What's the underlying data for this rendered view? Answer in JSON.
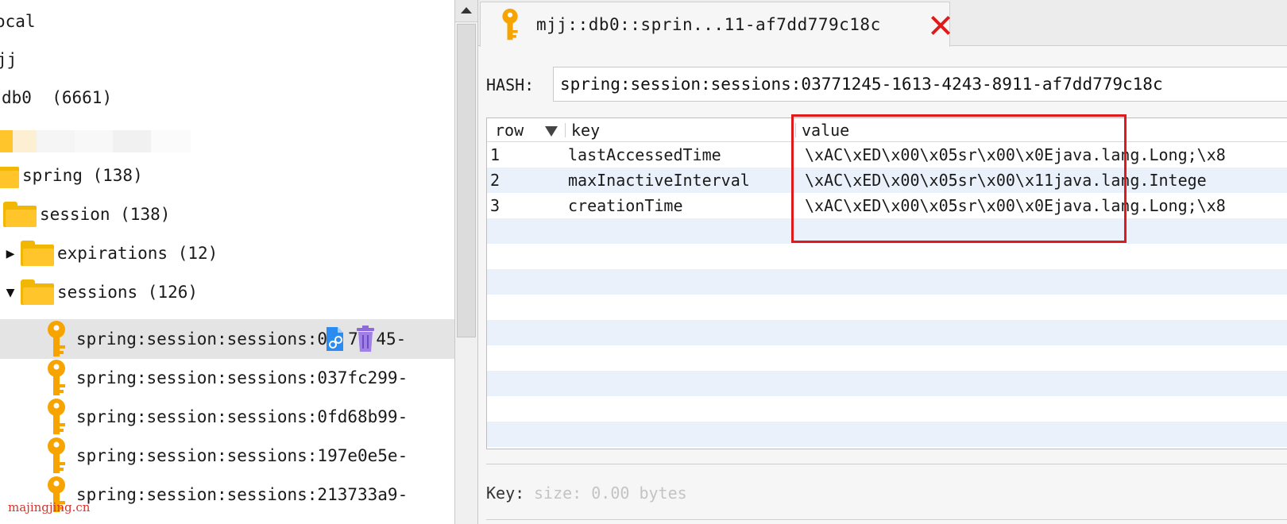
{
  "tree": {
    "items": [
      {
        "label": "ocal",
        "count": ""
      },
      {
        "label": "jj",
        "count": ""
      },
      {
        "label": "db0",
        "count": "  (6661)"
      },
      {
        "label": "spring",
        "count": " (138)"
      },
      {
        "label": "session",
        "count": " (138)"
      },
      {
        "label": "expirations",
        "count": " (12)",
        "arrow": "▶"
      },
      {
        "label": "sessions",
        "count": " (126)",
        "arrow": "▼"
      }
    ],
    "keys": [
      "spring:session:sessions:0",
      "spring:session:sessions:037fc299-",
      "spring:session:sessions:0fd68b99-",
      "spring:session:sessions:197e0e5e-",
      "spring:session:sessions:213733a9-"
    ],
    "selected_key_tail": "45-",
    "selected_key_mid": "71"
  },
  "tab": {
    "title": "mjj::db0::sprin...11-af7dd779c18c",
    "close_icon": "close-icon"
  },
  "hash": {
    "label": "HASH:",
    "value": "spring:session:sessions:03771245-1613-4243-8911-af7dd779c18c"
  },
  "table": {
    "headers": {
      "row": "row",
      "key": "key",
      "value": "value"
    },
    "rows": [
      {
        "row": "1",
        "key": "lastAccessedTime",
        "value": "\\xAC\\xED\\x00\\x05sr\\x00\\x0Ejava.lang.Long;\\x8"
      },
      {
        "row": "2",
        "key": "maxInactiveInterval",
        "value": "\\xAC\\xED\\x00\\x05sr\\x00\\x11java.lang.Intege"
      },
      {
        "row": "3",
        "key": "creationTime",
        "value": "\\xAC\\xED\\x00\\x05sr\\x00\\x0Ejava.lang.Long;\\x8"
      }
    ]
  },
  "footer": {
    "key_label": "Key:",
    "size_text": "size: 0.00 bytes"
  },
  "watermark": "majingjing.cn",
  "colors": {
    "accent_red": "#e01a1a",
    "folder_yellow": "#ffc52a",
    "key_orange": "#f7a400",
    "row_alt": "#eaf1fb",
    "selected_row": "#e4e4e4"
  }
}
